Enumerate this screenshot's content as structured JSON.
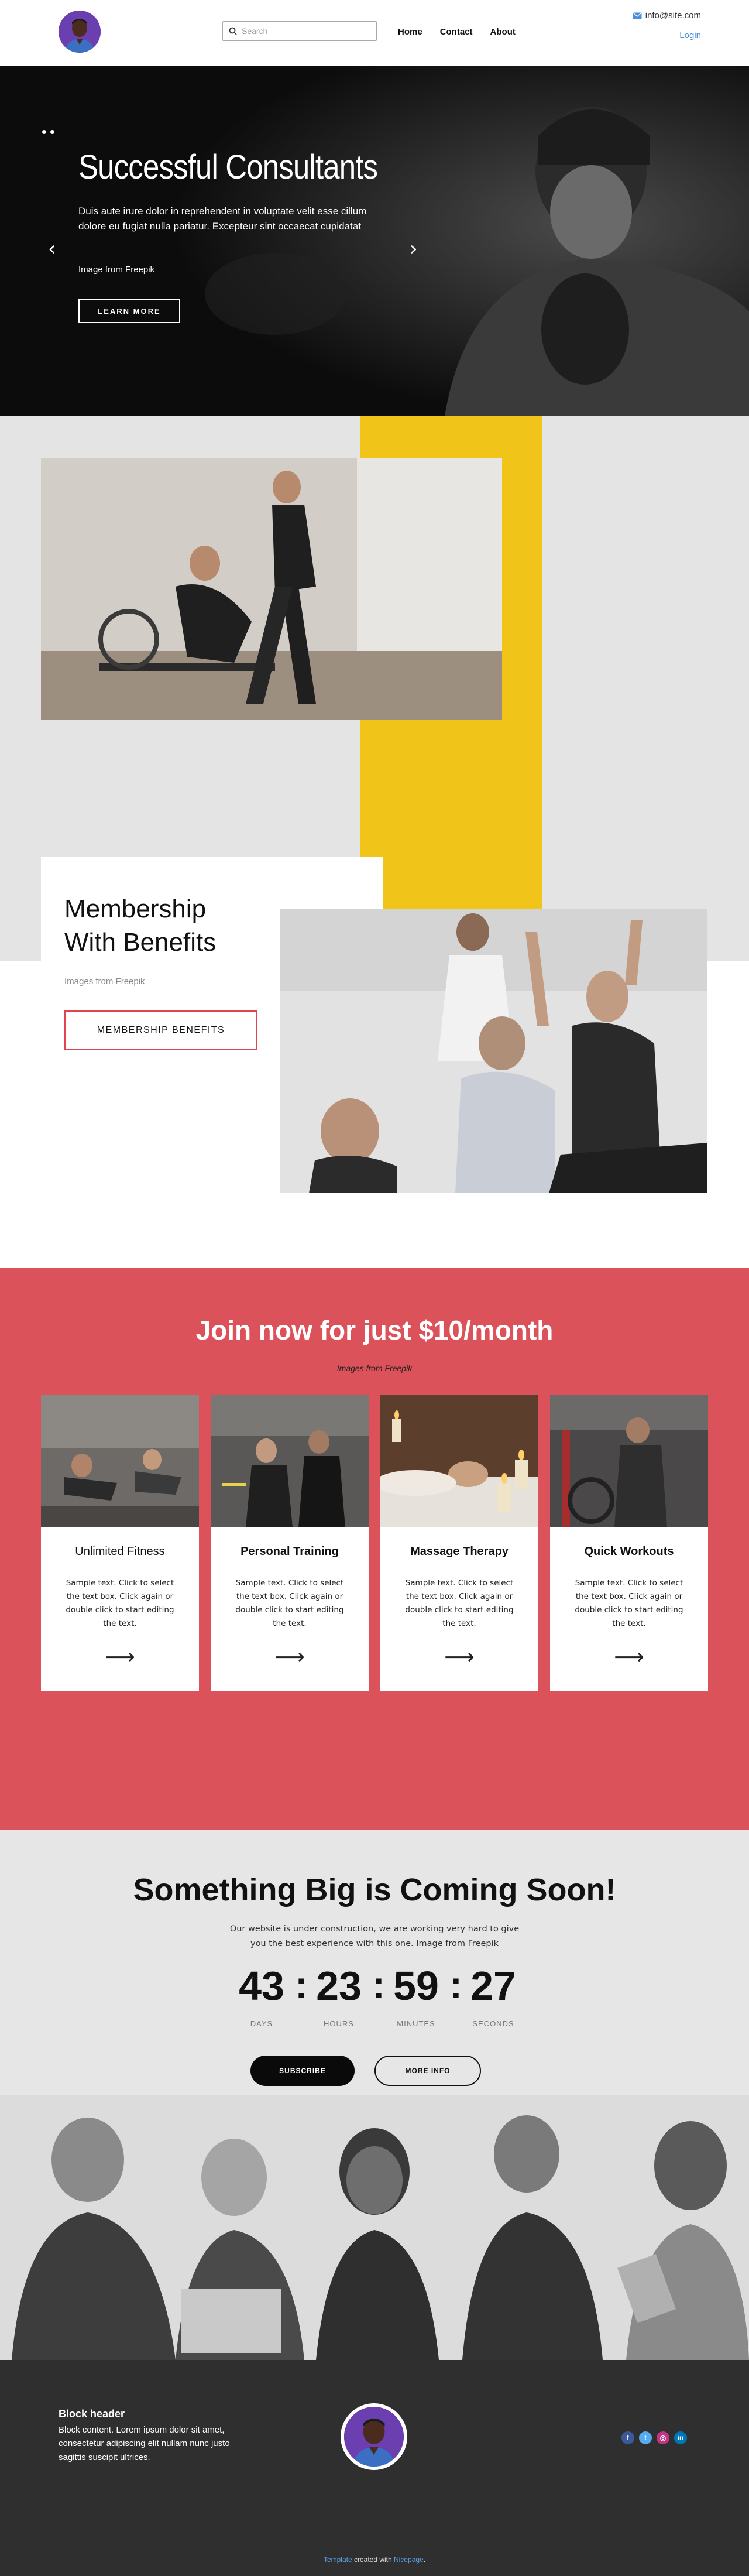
{
  "header": {
    "search_placeholder": "Search",
    "nav": [
      "Home",
      "Contact",
      "About"
    ],
    "email": "info@site.com",
    "login": "Login"
  },
  "hero": {
    "title": "Successful Consultants",
    "text": "Duis aute irure dolor in reprehendent in voluptate velit esse cillum dolore eu fugiat nulla pariatur. Excepteur sint occaecat cupidatat",
    "credit_prefix": "Image from ",
    "credit_link": "Freepik",
    "button": "LEARN MORE",
    "prev_arrow": "‹",
    "next_arrow": "›"
  },
  "membership": {
    "title_line1": "Membership",
    "title_line2": "With Benefits",
    "credit_prefix": "Images from ",
    "credit_link": "Freepik",
    "button": "MEMBERSHIP BENEFITS"
  },
  "join": {
    "title": "Join now for just $10/month",
    "credit_prefix": "Images from ",
    "credit_link": "Freepik",
    "cards": [
      {
        "title": "Unlimited Fitness",
        "text": "Sample text. Click to select the text box. Click again or double click to start editing the text."
      },
      {
        "title": "Personal Training",
        "text": "Sample text. Click to select the text box. Click again or double click to start editing the text."
      },
      {
        "title": "Massage Therapy",
        "text": "Sample text. Click to select the text box. Click again or double click to start editing the text."
      },
      {
        "title": "Quick Workouts",
        "text": "Sample text. Click to select the text box. Click again or double click to start editing the text."
      }
    ]
  },
  "soon": {
    "title": "Something Big is Coming Soon!",
    "text": "Our website is under construction, we are working very hard to give you the best experience with this one. Image from ",
    "credit_link": "Freepik",
    "days": "43",
    "hours": "23",
    "minutes": "59",
    "seconds": "27",
    "sep": ":",
    "label_days": "DAYS",
    "label_hours": "HOURS",
    "label_minutes": "MINUTES",
    "label_seconds": "SECONDS",
    "subscribe": "SUBSCRIBE",
    "more_info": "MORE INFO"
  },
  "footer": {
    "header": "Block header",
    "content": "Block content. Lorem ipsum dolor sit amet, consectetur adipiscing elit nullam nunc justo sagittis suscipit ultrices.",
    "credit_link1": "Template",
    "credit_mid": " created with ",
    "credit_link2": "Nicepage",
    "credit_end": ".",
    "social_icons": [
      "facebook-icon",
      "twitter-icon",
      "instagram-icon",
      "linkedin-icon"
    ],
    "social_colors": [
      "#3b5998",
      "#55acee",
      "#c13584",
      "#0077b5"
    ]
  }
}
